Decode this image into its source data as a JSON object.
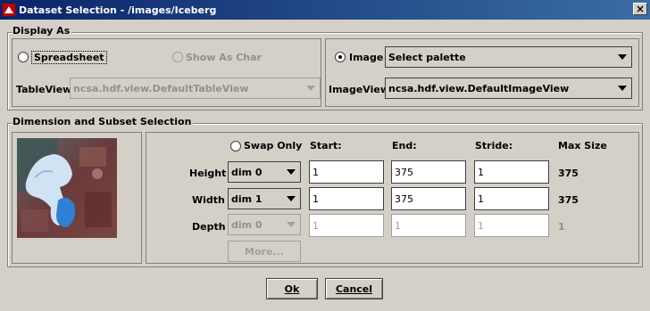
{
  "window": {
    "title": "Dataset Selection - /images/Iceberg",
    "close_glyph": "×"
  },
  "display_as": {
    "legend": "Display As",
    "spreadsheet_label": "Spreadsheet",
    "show_as_char_label": "Show As Char",
    "tableview_label": "TableView:",
    "tableview_value": "ncsa.hdf.view.DefaultTableView",
    "image_label": "Image",
    "palette_value": "Select palette",
    "imageview_label": "ImageView:",
    "imageview_value": "ncsa.hdf.view.DefaultImageView",
    "selected": "Image"
  },
  "subset": {
    "legend": "Dimension and Subset Selection",
    "swap_only_label": "Swap Only",
    "headers": {
      "start": "Start:",
      "end": "End:",
      "stride": "Stride:",
      "max_size": "Max Size"
    },
    "rows": [
      {
        "label": "Height",
        "dim": "dim 0",
        "start": "1",
        "end": "375",
        "stride": "1",
        "max": "375",
        "enabled": true
      },
      {
        "label": "Width",
        "dim": "dim 1",
        "start": "1",
        "end": "375",
        "stride": "1",
        "max": "375",
        "enabled": true
      },
      {
        "label": "Depth",
        "dim": "dim 0",
        "start": "1",
        "end": "1",
        "stride": "1",
        "max": "1",
        "enabled": false
      }
    ],
    "more_label": "More..."
  },
  "buttons": {
    "ok": "Ok",
    "cancel": "Cancel"
  }
}
